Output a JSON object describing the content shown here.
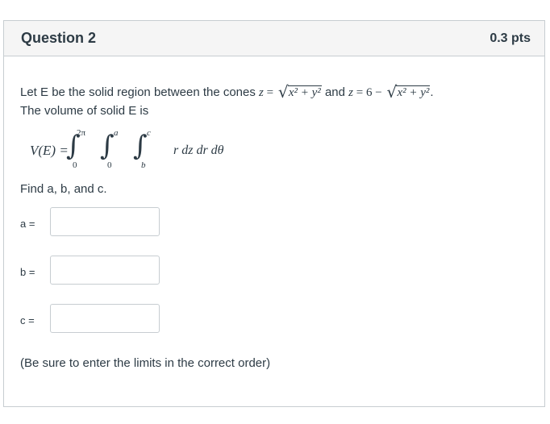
{
  "question": {
    "title": "Question 2",
    "points": "0.3 pts"
  },
  "prompt": {
    "line1_prefix": "Let E be the solid region between the cones ",
    "eq1_lhs": "z",
    "eq1_eq": " = ",
    "radicand": "x² + y²",
    "connector": " and ",
    "eq2_lhs": "z",
    "eq2_mid": " = 6 − ",
    "period": ".",
    "line2": "The volume of solid E is"
  },
  "integral": {
    "lhs": "V(E) = ",
    "outer_upper": "2π",
    "outer_lower": "0",
    "middle_upper": "a",
    "middle_lower": "0",
    "inner_upper": "c",
    "inner_lower": "b",
    "integrand": "r dz dr dθ"
  },
  "instruction": "Find a, b, and c.",
  "answers": [
    {
      "label": "a =",
      "value": ""
    },
    {
      "label": "b =",
      "value": ""
    },
    {
      "label": "c =",
      "value": ""
    }
  ],
  "note": "(Be sure to enter the limits in the correct order)"
}
